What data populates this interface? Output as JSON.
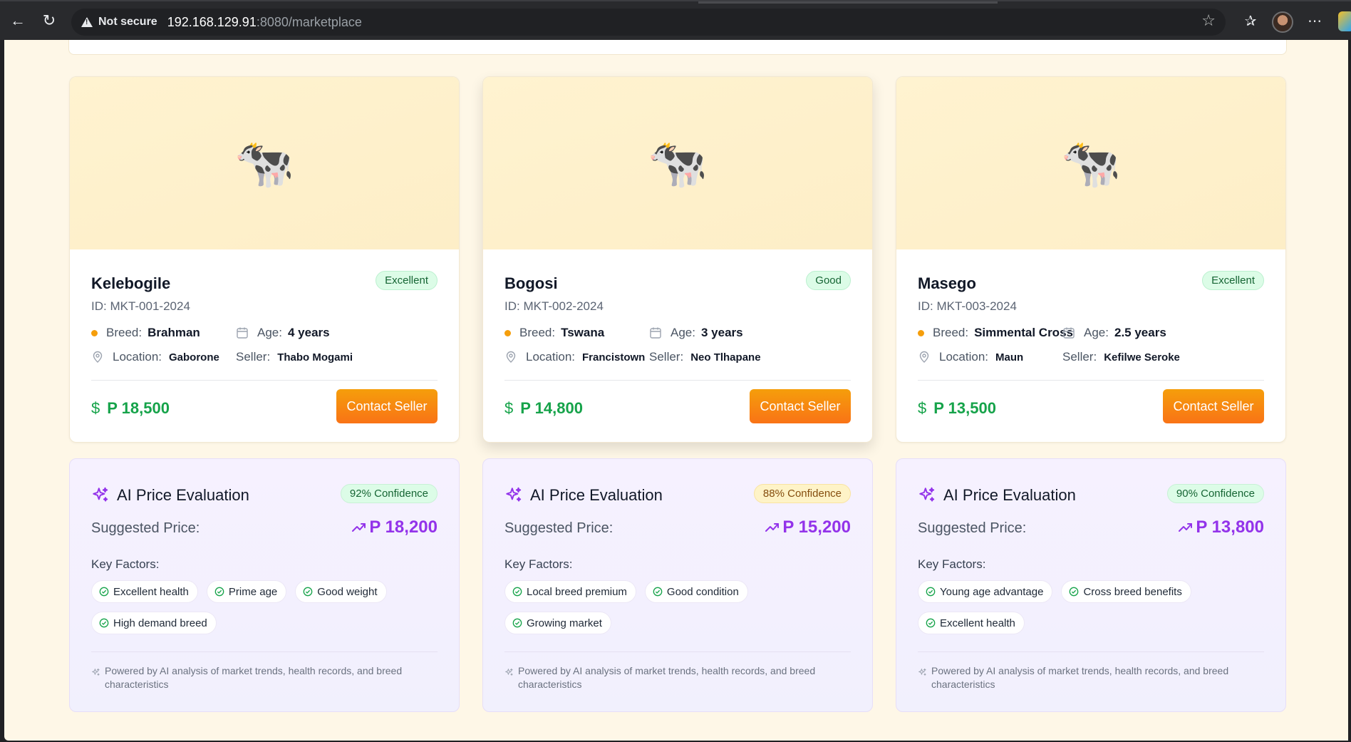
{
  "browser": {
    "security_label": "Not secure",
    "url_host": "192.168.129.91",
    "url_path": ":8080/marketplace"
  },
  "colors": {
    "accent_orange": "#f97316",
    "price_green": "#16a34a",
    "ai_purple": "#9333ea",
    "page_bg": "#fef7e7"
  },
  "labels": {
    "breed": "Breed:",
    "age": "Age:",
    "location": "Location:",
    "seller": "Seller:",
    "ai_title": "AI Price Evaluation",
    "suggested": "Suggested Price:",
    "key_factors": "Key Factors:",
    "footnote": "Powered by AI analysis of market trends, health records, and breed characteristics"
  },
  "listings": [
    {
      "name": "Kelebogile",
      "badge": "Excellent",
      "id": "ID: MKT-001-2024",
      "breed": "Brahman",
      "age": "4 years",
      "location": "Gaborone",
      "seller": "Thabo Mogami",
      "price": "P 18,500",
      "contact": "Contact Seller",
      "ai": {
        "confidence": "92% Confidence",
        "confidence_color": "green",
        "suggested": "P 18,200",
        "factors": [
          "Excellent health",
          "Prime age",
          "Good weight",
          "High demand breed"
        ]
      }
    },
    {
      "name": "Bogosi",
      "badge": "Good",
      "id": "ID: MKT-002-2024",
      "breed": "Tswana",
      "age": "3 years",
      "location": "Francistown",
      "seller": "Neo Tlhapane",
      "price": "P 14,800",
      "contact": "Contact Seller",
      "ai": {
        "confidence": "88% Confidence",
        "confidence_color": "yellow",
        "suggested": "P 15,200",
        "factors": [
          "Local breed premium",
          "Good condition",
          "Growing market"
        ]
      }
    },
    {
      "name": "Masego",
      "badge": "Excellent",
      "id": "ID: MKT-003-2024",
      "breed": "Simmental Cross",
      "age": "2.5 years",
      "location": "Maun",
      "seller": "Kefilwe Seroke",
      "price": "P 13,500",
      "contact": "Contact Seller",
      "ai": {
        "confidence": "90% Confidence",
        "confidence_color": "green",
        "suggested": "P 13,800",
        "factors": [
          "Young age advantage",
          "Cross breed benefits",
          "Excellent health"
        ]
      }
    }
  ]
}
